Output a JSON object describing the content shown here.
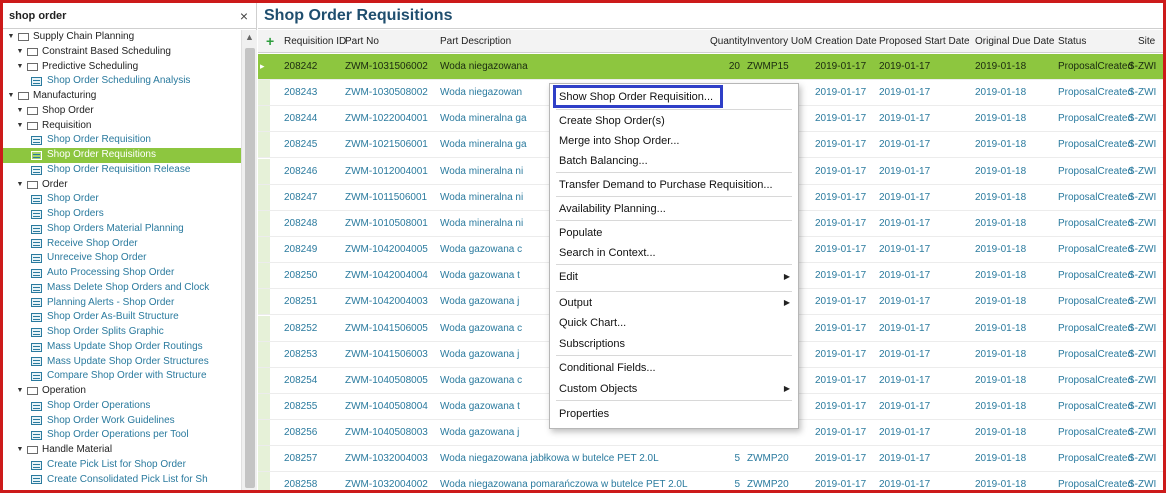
{
  "navigator": {
    "search_value": "shop order",
    "items": [
      {
        "label": "Supply Chain Planning",
        "type": "folder",
        "level": 0
      },
      {
        "label": "Constraint Based Scheduling",
        "type": "folder",
        "level": 1
      },
      {
        "label": "Predictive Scheduling",
        "type": "folder",
        "level": 1
      },
      {
        "label": "Shop Order Scheduling Analysis",
        "type": "leaf",
        "level": 2
      },
      {
        "label": "Manufacturing",
        "type": "folder",
        "level": 0
      },
      {
        "label": "Shop Order",
        "type": "folder",
        "level": 1
      },
      {
        "label": "Requisition",
        "type": "folder",
        "level": 1
      },
      {
        "label": "Shop Order Requisition",
        "type": "leaf",
        "level": 2
      },
      {
        "label": "Shop Order Requisitions",
        "type": "leaf",
        "level": 2,
        "selected": true
      },
      {
        "label": "Shop Order Requisition Release",
        "type": "leaf",
        "level": 2
      },
      {
        "label": "Order",
        "type": "folder",
        "level": 1
      },
      {
        "label": "Shop Order",
        "type": "leaf",
        "level": 2
      },
      {
        "label": "Shop Orders",
        "type": "leaf",
        "level": 2
      },
      {
        "label": "Shop Orders Material Planning",
        "type": "leaf",
        "level": 2
      },
      {
        "label": "Receive Shop Order",
        "type": "leaf",
        "level": 2
      },
      {
        "label": "Unreceive Shop Order",
        "type": "leaf",
        "level": 2
      },
      {
        "label": "Auto Processing Shop Order",
        "type": "leaf",
        "level": 2
      },
      {
        "label": "Mass Delete Shop Orders and Clock",
        "type": "leaf",
        "level": 2
      },
      {
        "label": "Planning Alerts - Shop Order",
        "type": "leaf",
        "level": 2
      },
      {
        "label": "Shop Order As-Built Structure",
        "type": "leaf",
        "level": 2
      },
      {
        "label": "Shop Order Splits Graphic",
        "type": "leaf",
        "level": 2
      },
      {
        "label": "Mass Update Shop Order Routings",
        "type": "leaf",
        "level": 2
      },
      {
        "label": "Mass Update Shop Order Structures",
        "type": "leaf",
        "level": 2
      },
      {
        "label": "Compare Shop Order with Structure",
        "type": "leaf",
        "level": 2
      },
      {
        "label": "Operation",
        "type": "folder",
        "level": 1
      },
      {
        "label": "Shop Order Operations",
        "type": "leaf",
        "level": 2
      },
      {
        "label": "Shop Order Work Guidelines",
        "type": "leaf",
        "level": 2
      },
      {
        "label": "Shop Order Operations per Tool",
        "type": "leaf",
        "level": 2
      },
      {
        "label": "Handle Material",
        "type": "folder",
        "level": 1
      },
      {
        "label": "Create Pick List for Shop Order",
        "type": "leaf",
        "level": 2
      },
      {
        "label": "Create Consolidated Pick List for Sh",
        "type": "leaf",
        "level": 2
      }
    ]
  },
  "page_title": "Shop Order Requisitions",
  "grid": {
    "add_icon": "+",
    "columns": [
      "Requisition ID",
      "Part No",
      "Part Description",
      "Quantity",
      "Inventory UoM",
      "Creation Date",
      "Proposed Start Date",
      "Original Due Date",
      "Status",
      "Site"
    ],
    "rows": [
      {
        "id": "208242",
        "part": "ZWM-1031506002",
        "desc": "Woda niegazowana",
        "qty": "20",
        "uom": "ZWMP15",
        "created": "2019-01-17",
        "start": "2019-01-17",
        "due": "2019-01-18",
        "status": "ProposalCreated",
        "site": "S-ZWI",
        "selected": true
      },
      {
        "id": "208243",
        "part": "ZWM-1030508002",
        "desc": "Woda niegazowan",
        "qty": "",
        "uom": "",
        "created": "2019-01-17",
        "start": "2019-01-17",
        "due": "2019-01-18",
        "status": "ProposalCreated",
        "site": "S-ZWI"
      },
      {
        "id": "208244",
        "part": "ZWM-1022004001",
        "desc": "Woda mineralna ga",
        "qty": "",
        "uom": "",
        "created": "2019-01-17",
        "start": "2019-01-17",
        "due": "2019-01-18",
        "status": "ProposalCreated",
        "site": "S-ZWI"
      },
      {
        "id": "208245",
        "part": "ZWM-1021506001",
        "desc": "Woda mineralna ga",
        "qty": "",
        "uom": "",
        "created": "2019-01-17",
        "start": "2019-01-17",
        "due": "2019-01-18",
        "status": "ProposalCreated",
        "site": "S-ZWI"
      },
      {
        "id": "208246",
        "part": "ZWM-1012004001",
        "desc": "Woda mineralna ni",
        "qty": "",
        "uom": "",
        "created": "2019-01-17",
        "start": "2019-01-17",
        "due": "2019-01-18",
        "status": "ProposalCreated",
        "site": "S-ZWI"
      },
      {
        "id": "208247",
        "part": "ZWM-1011506001",
        "desc": "Woda mineralna ni",
        "qty": "",
        "uom": "",
        "created": "2019-01-17",
        "start": "2019-01-17",
        "due": "2019-01-18",
        "status": "ProposalCreated",
        "site": "S-ZWI"
      },
      {
        "id": "208248",
        "part": "ZWM-1010508001",
        "desc": "Woda mineralna ni",
        "qty": "",
        "uom": "",
        "created": "2019-01-17",
        "start": "2019-01-17",
        "due": "2019-01-18",
        "status": "ProposalCreated",
        "site": "S-ZWI"
      },
      {
        "id": "208249",
        "part": "ZWM-1042004005",
        "desc": "Woda gazowana c",
        "qty": "",
        "uom": "",
        "created": "2019-01-17",
        "start": "2019-01-17",
        "due": "2019-01-18",
        "status": "ProposalCreated",
        "site": "S-ZWI"
      },
      {
        "id": "208250",
        "part": "ZWM-1042004004",
        "desc": "Woda gazowana t",
        "qty": "",
        "uom": "",
        "created": "2019-01-17",
        "start": "2019-01-17",
        "due": "2019-01-18",
        "status": "ProposalCreated",
        "site": "S-ZWI"
      },
      {
        "id": "208251",
        "part": "ZWM-1042004003",
        "desc": "Woda gazowana j",
        "qty": "",
        "uom": "",
        "created": "2019-01-17",
        "start": "2019-01-17",
        "due": "2019-01-18",
        "status": "ProposalCreated",
        "site": "S-ZWI"
      },
      {
        "id": "208252",
        "part": "ZWM-1041506005",
        "desc": "Woda gazowana c",
        "qty": "",
        "uom": "",
        "created": "2019-01-17",
        "start": "2019-01-17",
        "due": "2019-01-18",
        "status": "ProposalCreated",
        "site": "S-ZWI"
      },
      {
        "id": "208253",
        "part": "ZWM-1041506003",
        "desc": "Woda gazowana j",
        "qty": "",
        "uom": "",
        "created": "2019-01-17",
        "start": "2019-01-17",
        "due": "2019-01-18",
        "status": "ProposalCreated",
        "site": "S-ZWI"
      },
      {
        "id": "208254",
        "part": "ZWM-1040508005",
        "desc": "Woda gazowana c",
        "qty": "",
        "uom": "",
        "created": "2019-01-17",
        "start": "2019-01-17",
        "due": "2019-01-18",
        "status": "ProposalCreated",
        "site": "S-ZWI"
      },
      {
        "id": "208255",
        "part": "ZWM-1040508004",
        "desc": "Woda gazowana t",
        "qty": "",
        "uom": "",
        "created": "2019-01-17",
        "start": "2019-01-17",
        "due": "2019-01-18",
        "status": "ProposalCreated",
        "site": "S-ZWI"
      },
      {
        "id": "208256",
        "part": "ZWM-1040508003",
        "desc": "Woda gazowana j",
        "qty": "",
        "uom": "",
        "created": "2019-01-17",
        "start": "2019-01-17",
        "due": "2019-01-18",
        "status": "ProposalCreated",
        "site": "S-ZWI"
      },
      {
        "id": "208257",
        "part": "ZWM-1032004003",
        "desc": "Woda niegazowana jabłkowa w butelce PET 2.0L",
        "qty": "5",
        "uom": "ZWMP20",
        "created": "2019-01-17",
        "start": "2019-01-17",
        "due": "2019-01-18",
        "status": "ProposalCreated",
        "site": "S-ZWI"
      },
      {
        "id": "208258",
        "part": "ZWM-1032004002",
        "desc": "Woda niegazowana pomarańczowa w butelce PET 2.0L",
        "qty": "5",
        "uom": "ZWMP20",
        "created": "2019-01-17",
        "start": "2019-01-17",
        "due": "2019-01-18",
        "status": "ProposalCreated",
        "site": "S-ZWI"
      }
    ]
  },
  "context_menu": {
    "highlight_color": "#2f3fc7",
    "items": [
      {
        "label": "Show Shop Order Requisition...",
        "submenu": false
      },
      {
        "label": "Create Shop Order(s)",
        "submenu": false
      },
      {
        "label": "Merge into Shop Order...",
        "submenu": false
      },
      {
        "label": "Batch Balancing...",
        "submenu": false
      },
      {
        "label": "Transfer Demand to Purchase Requisition...",
        "submenu": false
      },
      {
        "label": "Availability Planning...",
        "submenu": false
      },
      {
        "label": "Populate",
        "submenu": false
      },
      {
        "label": "Search in Context...",
        "submenu": false
      },
      {
        "label": "Edit",
        "submenu": true
      },
      {
        "label": "Output",
        "submenu": true
      },
      {
        "label": "Quick Chart...",
        "submenu": false
      },
      {
        "label": "Subscriptions",
        "submenu": false
      },
      {
        "label": "Conditional Fields...",
        "submenu": false
      },
      {
        "label": "Custom Objects",
        "submenu": true
      },
      {
        "label": "Properties",
        "submenu": false
      }
    ]
  },
  "colors": {
    "accent_green": "#8dc63f",
    "link_blue": "#2a7a9e",
    "title_blue": "#1f4e6e",
    "frame_red": "#cc1a1a"
  }
}
